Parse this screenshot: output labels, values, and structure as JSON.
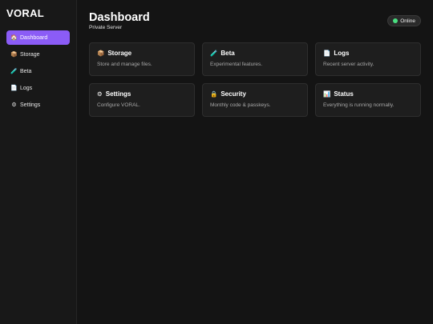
{
  "brand": "VORAL",
  "sidebar": {
    "items": [
      {
        "icon": "🏠",
        "label": "Dashboard",
        "active": true
      },
      {
        "icon": "📦",
        "label": "Storage"
      },
      {
        "icon": "🧪",
        "label": "Beta"
      },
      {
        "icon": "📄",
        "label": "Logs"
      },
      {
        "icon": "⚙",
        "label": "Settings"
      }
    ]
  },
  "header": {
    "title": "Dashboard",
    "subtitle": "Private Server",
    "status": "Online"
  },
  "cards": [
    {
      "icon": "📦",
      "title": "Storage",
      "desc": "Store and manage files."
    },
    {
      "icon": "🧪",
      "title": "Beta",
      "desc": "Experimental features."
    },
    {
      "icon": "📄",
      "title": "Logs",
      "desc": "Recent server activity."
    },
    {
      "icon": "⚙",
      "title": "Settings",
      "desc": "Configure VORAL."
    },
    {
      "icon": "🔒",
      "title": "Security",
      "desc": "Monthly code & passkeys."
    },
    {
      "icon": "📊",
      "title": "Status",
      "desc": "Everything is running normally."
    }
  ],
  "colors": {
    "accent": "#8b5cf6",
    "online": "#4ade80",
    "background": "#141414",
    "sidebar": "#181818",
    "card": "#1e1e1e"
  }
}
